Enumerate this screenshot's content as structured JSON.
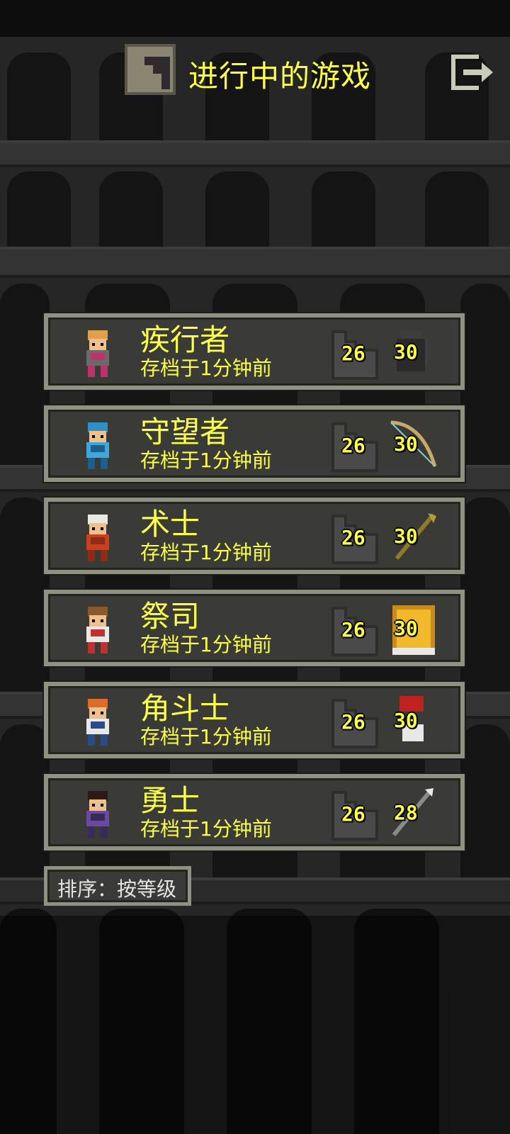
{
  "header": {
    "title": "进行中的游戏",
    "title_icon": "stairs-icon",
    "exit_icon": "exit-icon"
  },
  "slots": [
    {
      "name": "疾行者",
      "saved": "存档于1分钟前",
      "depth": "26",
      "level": "30",
      "hero_icon": "rogue-hero-icon",
      "item_icon": "cloak-icon"
    },
    {
      "name": "守望者",
      "saved": "存档于1分钟前",
      "depth": "26",
      "level": "30",
      "hero_icon": "huntress-hero-icon",
      "item_icon": "bow-icon"
    },
    {
      "name": "术士",
      "saved": "存档于1分钟前",
      "depth": "26",
      "level": "30",
      "hero_icon": "mage-hero-icon",
      "item_icon": "staff-icon"
    },
    {
      "name": "祭司",
      "saved": "存档于1分钟前",
      "depth": "26",
      "level": "30",
      "hero_icon": "cleric-hero-icon",
      "item_icon": "tome-icon"
    },
    {
      "name": "角斗士",
      "saved": "存档于1分钟前",
      "depth": "26",
      "level": "30",
      "hero_icon": "duelist-hero-icon",
      "item_icon": "gauntlet-icon"
    },
    {
      "name": "勇士",
      "saved": "存档于1分钟前",
      "depth": "26",
      "level": "28",
      "hero_icon": "warrior-hero-icon",
      "item_icon": "sword-icon"
    }
  ],
  "sort": {
    "label": "排序：按等级"
  },
  "colors": {
    "accent": "#fcff4c",
    "frame": "#8f9181",
    "panel": "#3a3a36"
  }
}
